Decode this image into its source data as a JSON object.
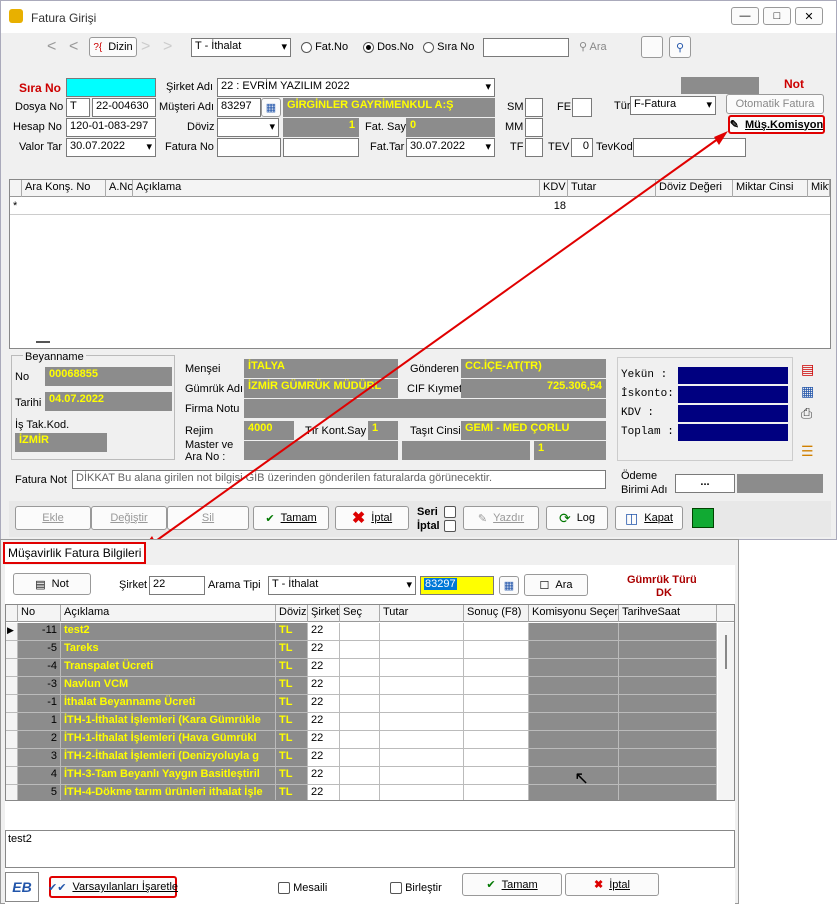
{
  "main": {
    "title": "Fatura Girişi",
    "toolbar": {
      "dizin": "Dizin",
      "type_value": "T - İthalat",
      "r1": "Fat.No",
      "r2": "Dos.No",
      "r3": "Sıra No",
      "search_btn": "Ara"
    },
    "form": {
      "sira_no": "Sıra No",
      "sirket_adi": "Şirket Adı",
      "sirket_val": "22 : EVRİM YAZILIM  2022",
      "not": "Not",
      "dosya_no": "Dosya No",
      "dosya_pre": "T",
      "dosya_val": "22-004630",
      "musteri_adi": "Müşteri Adı",
      "musteri_code": "83297",
      "musteri_name": "GİRGİNLER GAYRİMENKUL A:Ş",
      "sm": "SM",
      "fe": "FE",
      "tur": "Tür",
      "tur_val": "F-Fatura",
      "otomatik": "Otomatik Fatura",
      "hesap_no": "Hesap No",
      "hesap_val": "120-01-083-297",
      "doviz": "Döviz",
      "doviz_num": "1",
      "fat_say": "Fat. Say",
      "fat_say_val": "0",
      "mm": "MM",
      "mus_kom": "Müş.Komisyon",
      "valor_tar": "Valor Tar",
      "valor_val": "30.07.2022",
      "fatura_no": "Fatura No",
      "fat_tar": "Fat.Tar",
      "fat_tar_val": "30.07.2022",
      "tf": "TF",
      "tev": "TEV",
      "tev_val": "0",
      "tevkod": "TevKod"
    },
    "grid": {
      "headers": [
        "Ara Konş. No",
        "A.No",
        "Açıklama",
        "KDV",
        "Tutar",
        "Döviz Değeri",
        "Miktar Cinsi",
        "Mikt"
      ],
      "row_marker": "*",
      "kdv": "18"
    },
    "beyanname": {
      "title": "Beyanname",
      "no": "No",
      "no_val": "00068855",
      "tarihi": "Tarihi",
      "tarihi_val": "04.07.2022",
      "is_tak": "İş Tak.Kod.",
      "is_tak_val": "İZMİR"
    },
    "details": {
      "mensei": "Menşei",
      "mensei_val": "İTALYA",
      "gonderen": "Gönderen",
      "gonderen_val": "CC.İÇE-AT(TR)",
      "gumruk": "Gümrük Adı",
      "gumruk_val": "İZMİR GÜMRÜK MÜDÜRL",
      "cif": "CIF Kıymet",
      "cif_val": "725.306,54",
      "firma": "Firma Notu",
      "rejim": "Rejim",
      "rejim_val": "4000",
      "tir": "Tır Kont.Say",
      "tir_val": "1",
      "tasit": "Taşıt Cinsi",
      "tasit_val": "GEMİ - MED ÇORLU",
      "master": "Master ve",
      "ara_no": "Ara No :",
      "master_val": "1"
    },
    "totals": {
      "yekun": "Yekün   :",
      "iskonto": "İskonto:",
      "kdv": "KDV     :",
      "toplam": "Toplam  :"
    },
    "fatura_not": "Fatura Not",
    "fatura_not_val": "DİKKAT Bu alana girilen not bilgisi GİB üzerinden gönderilen faturalarda görünecektir.",
    "odeme": "Ödeme",
    "birimi": "Birimi Adı",
    "odeme_val": "...",
    "buttons": {
      "ekle": "Ekle",
      "degistir": "Değiştir",
      "sil": "Sil",
      "tamam": "Tamam",
      "iptal": "İptal",
      "seri": "Seri",
      "iptal2": "İptal",
      "yazdir": "Yazdır",
      "log": "Log",
      "kapat": "Kapat"
    }
  },
  "dialog": {
    "title": "Müşavirlik Fatura Bilgileri",
    "not": "Not",
    "sirket": "Şirket",
    "sirket_val": "22",
    "arama_tipi": "Arama Tipi",
    "arama_val": "T - İthalat",
    "code": "83297",
    "ara": "Ara",
    "gumruk_turu": "Gümrük Türü",
    "dk": "DK",
    "headers": [
      "No",
      "Açıklama",
      "Döviz",
      "Şirket",
      "Seç",
      "Tutar",
      "Sonuç (F8)",
      "Komisyonu Seçen",
      "TarihveSaat"
    ],
    "rows": [
      {
        "no": "-11",
        "desc": "test2",
        "doviz": "TL",
        "sirket": "22"
      },
      {
        "no": "-5",
        "desc": "Tareks",
        "doviz": "TL",
        "sirket": "22"
      },
      {
        "no": "-4",
        "desc": "Transpalet Ücreti",
        "doviz": "TL",
        "sirket": "22"
      },
      {
        "no": "-3",
        "desc": "Navlun VCM",
        "doviz": "TL",
        "sirket": "22"
      },
      {
        "no": "-1",
        "desc": "İthalat Beyanname Ücreti",
        "doviz": "TL",
        "sirket": "22"
      },
      {
        "no": "1",
        "desc": "İTH-1-İthalat İşlemleri  (Kara Gümrükle",
        "doviz": "TL",
        "sirket": "22"
      },
      {
        "no": "2",
        "desc": "İTH-1-İthalat İşlemleri  (Hava Gümrükl",
        "doviz": "TL",
        "sirket": "22"
      },
      {
        "no": "3",
        "desc": "İTH-2-İthalat İşlemleri (Denizyoluyla g",
        "doviz": "TL",
        "sirket": "22"
      },
      {
        "no": "4",
        "desc": "İTH-3-Tam Beyanlı Yaygın Basitleştiril",
        "doviz": "TL",
        "sirket": "22"
      },
      {
        "no": "5",
        "desc": "İTH-4-Dökme tarım ürünleri ithalat İşle",
        "doviz": "TL",
        "sirket": "22"
      }
    ],
    "memo": "test2",
    "varsayilan": "Varsayılanları İşaretle",
    "mesaili": "Mesaili",
    "birlestir": "Birleştir",
    "tamam": "Tamam",
    "iptal": "İptal"
  }
}
